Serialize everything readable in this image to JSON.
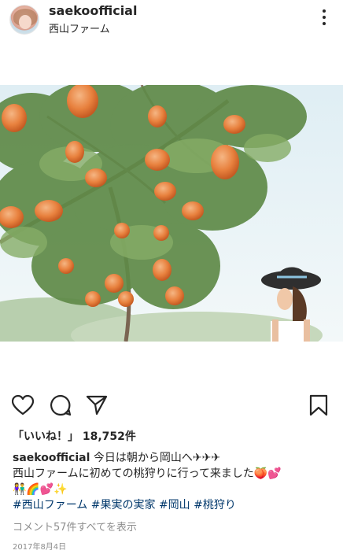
{
  "post": {
    "username": "saekoofficial",
    "location": "西山ファーム",
    "likes_label": "「いいね！」",
    "likes_count": "18,752件",
    "caption_line1": "今日は朝から岡山へ✈✈✈",
    "caption_line2": "西山ファームに初めての桃狩りに行って来ました🍑💕",
    "caption_line3": "👫🌈💕✨",
    "hashtags": [
      "#西山ファーム",
      "#果実の実家",
      "#岡山",
      "#桃狩り"
    ],
    "view_comments": "コメント57件すべてを表示",
    "date": "2017年8月4日"
  },
  "icons": {
    "more": "more-options-icon",
    "like": "heart-icon",
    "comment": "comment-icon",
    "share": "paper-plane-icon",
    "save": "bookmark-icon"
  },
  "colors": {
    "text": "#262626",
    "secondary": "#8e8e8e",
    "hashtag": "#00376b"
  }
}
